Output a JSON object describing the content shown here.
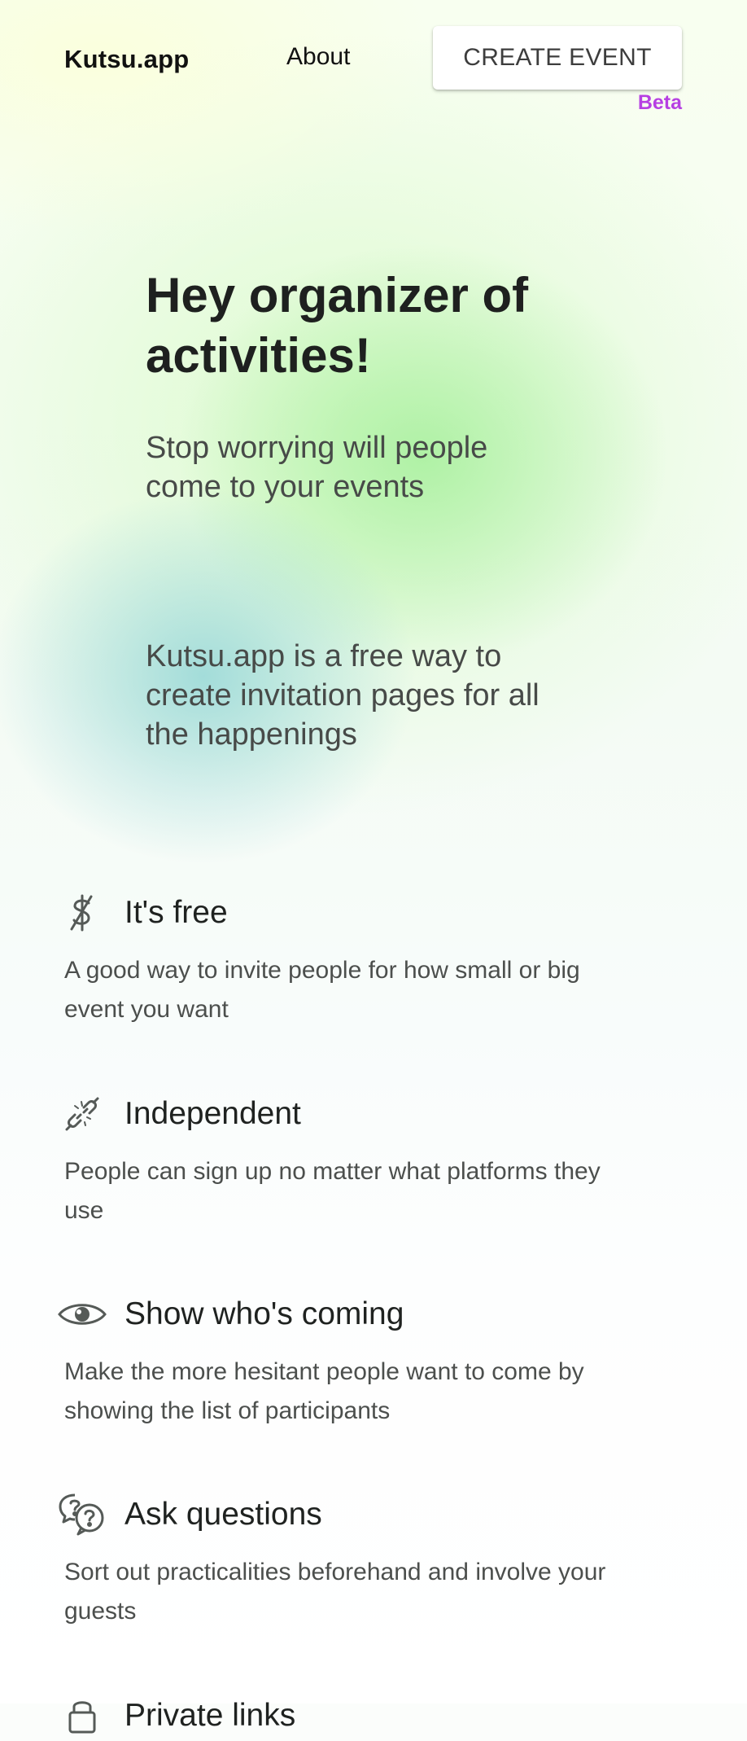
{
  "header": {
    "logo": "Kutsu.app",
    "nav_about": "About",
    "create_event": "CREATE EVENT",
    "beta": "Beta"
  },
  "hero": {
    "title": "Hey organizer of activities!",
    "subtitle": "Stop worrying will people come to your events",
    "description": "Kutsu.app is a free way to create invitation pages for all the happenings"
  },
  "features": [
    {
      "icon": "no-dollar-icon",
      "title": "It's free",
      "text": "A good way to invite people for how small or big event you want"
    },
    {
      "icon": "broken-link-icon",
      "title": "Independent",
      "text": "People can sign up no matter what platforms they use"
    },
    {
      "icon": "eye-icon",
      "title": "Show who's coming",
      "text": "Make the more hesitant people want to come by showing the list of participants"
    },
    {
      "icon": "question-bubbles-icon",
      "title": "Ask questions",
      "text": "Sort out practicalities beforehand and involve your guests"
    },
    {
      "icon": "lock-icon",
      "title": "Private links"
    }
  ],
  "colors": {
    "beta": "#b63fe2",
    "text_dark": "#1f2220",
    "text_muted": "#4c4f4d",
    "button_bg": "#ffffff"
  }
}
